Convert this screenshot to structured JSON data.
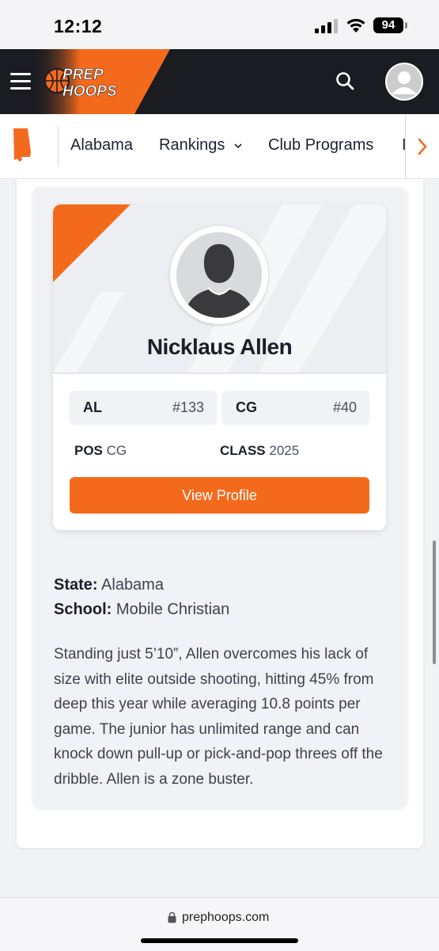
{
  "status_bar": {
    "time": "12:12",
    "battery": "94"
  },
  "header": {
    "brand_line1": "PREP",
    "brand_line2": "HOOPS"
  },
  "nav": {
    "items": [
      {
        "label": "Alabama"
      },
      {
        "label": "Rankings"
      },
      {
        "label": "Club Programs"
      }
    ]
  },
  "player": {
    "name": "Nicklaus Allen",
    "state_rank_label": "AL",
    "state_rank_value": "#133",
    "position_rank_label": "CG",
    "position_rank_value": "#40",
    "pos_label": "POS",
    "pos_value": "CG",
    "class_label": "CLASS",
    "class_value": "2025",
    "view_profile": "View Profile"
  },
  "article": {
    "state_label": "State:",
    "state_value": "Alabama",
    "school_label": "School:",
    "school_value": "Mobile Christian",
    "bio": "Standing just 5’10”, Allen overcomes his lack of size with elite outside shooting, hitting 45% from deep this year while averaging 10.8 points per game. The junior has unlimited range and can knock down pull-up or pick-and-pop threes off the dribble. Allen is a zone buster."
  },
  "browser": {
    "url": "prephoops.com"
  },
  "colors": {
    "accent": "#f46a1d",
    "header_bg": "#1b1c22"
  }
}
